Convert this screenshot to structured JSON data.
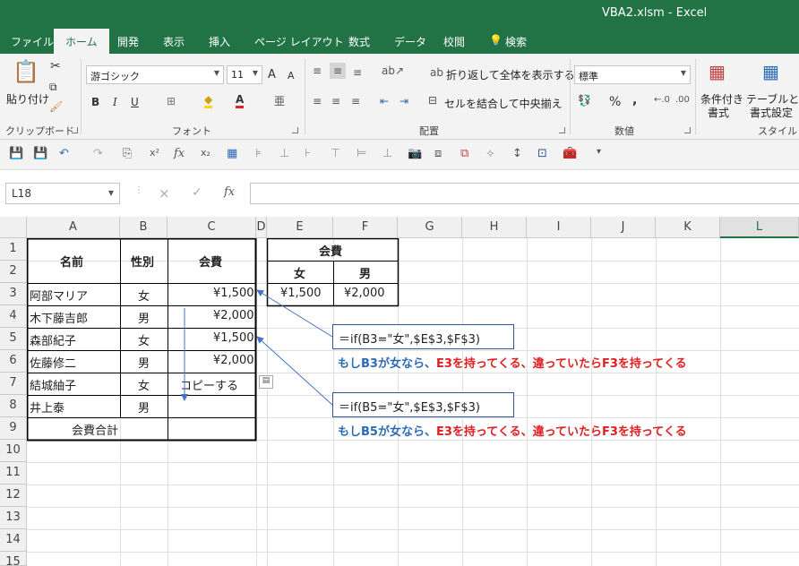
{
  "window": {
    "title": "VBA2.xlsm  -  Excel"
  },
  "tabs": [
    "ファイル",
    "ホーム",
    "開発",
    "表示",
    "挿入",
    "ページ レイアウト",
    "数式",
    "データ",
    "校閲",
    "検索"
  ],
  "tab_search_icon": "lightbulb-icon",
  "ribbon": {
    "clipboard": {
      "paste_label": "貼り付け",
      "group_label": "クリップボード"
    },
    "font": {
      "font_name": "游ゴシック",
      "font_size": "11",
      "bold": "B",
      "italic": "I",
      "underline": "U",
      "font_color_letter": "A",
      "grow": "A",
      "shrink": "A",
      "group_label": "フォント"
    },
    "alignment": {
      "wrap_text": "折り返して全体を表示する",
      "merge_center": "セルを結合して中央揃え",
      "group_label": "配置"
    },
    "number": {
      "format": "標準",
      "percent": "%",
      "comma": ",",
      "group_label": "数値"
    },
    "styles": {
      "conditional_line1": "条件付き",
      "conditional_line2": "書式",
      "table_line1": "テーブルとして",
      "table_line2": "書式設定",
      "group_label": "スタイル"
    }
  },
  "formula_bar": {
    "name_box": "L18",
    "fx": "fx",
    "cancel": "×",
    "enter": "✓"
  },
  "columns": [
    "A",
    "B",
    "C",
    "D",
    "E",
    "F",
    "G",
    "H",
    "I",
    "J",
    "K",
    "L"
  ],
  "selected_column": "L",
  "rows": [
    "1",
    "2",
    "3",
    "4",
    "5",
    "6",
    "7",
    "8",
    "9",
    "10",
    "11",
    "12",
    "13",
    "14",
    "15"
  ],
  "main_table": {
    "header_name": "名前",
    "header_gender": "性別",
    "header_fee": "会費",
    "records": [
      {
        "name": "阿部マリア",
        "gender": "女",
        "fee": "¥1,500"
      },
      {
        "name": "木下藤吉郎",
        "gender": "男",
        "fee": "¥2,000"
      },
      {
        "name": "森部紀子",
        "gender": "女",
        "fee": "¥1,500"
      },
      {
        "name": "佐藤修二",
        "gender": "男",
        "fee": "¥2,000"
      },
      {
        "name": "結城紬子",
        "gender": "女",
        "fee": "コピーする"
      },
      {
        "name": "井上泰",
        "gender": "男",
        "fee": ""
      }
    ],
    "total_label": "会費合計"
  },
  "fee_table": {
    "title": "会費",
    "female_label": "女",
    "male_label": "男",
    "female_fee": "¥1,500",
    "male_fee": "¥2,000"
  },
  "annotations": {
    "formula1": "＝if(B3=\"女\",$E$3,$F$3)",
    "note1_blue": "もしB3が女なら、",
    "note1_red": "E3を持ってくる、違っていたらF3を持ってくる",
    "formula2": "＝if(B5=\"女\",$E$3,$F$3)",
    "note2_blue": "もしB5が女なら、",
    "note2_red": "E3を持ってくる、違っていたらF3を持ってくる"
  },
  "colors": {
    "excel_green": "#217346",
    "annotation_blue": "#2e6bb5",
    "annotation_red": "#e02020",
    "arrow_blue": "#4472c4"
  }
}
